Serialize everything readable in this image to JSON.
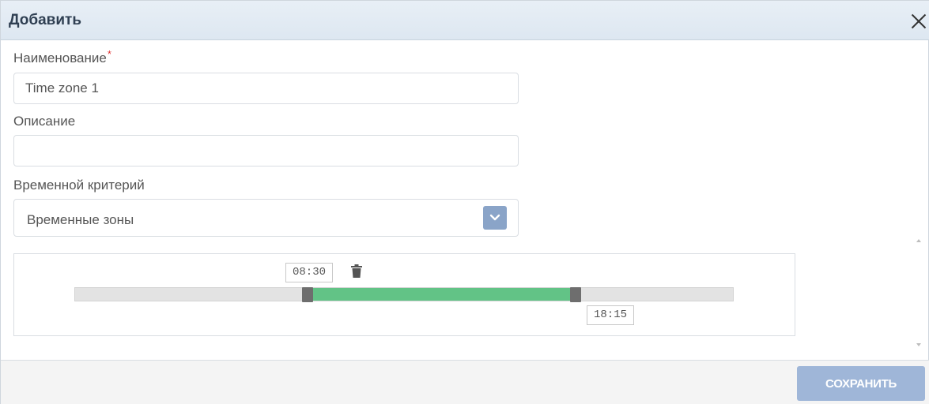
{
  "dialog": {
    "title": "Добавить"
  },
  "form": {
    "name_label": "Наименование",
    "required_mark": "*",
    "name_value": "Time zone 1",
    "description_label": "Описание",
    "description_value": "",
    "criterion_label": "Временной критерий",
    "criterion_selected": "Временные зоны"
  },
  "timeline": {
    "start_time": "08:30",
    "end_time": "18:15",
    "day_start": "00:00",
    "day_end": "24:00",
    "range_color": "#62c386"
  },
  "footer": {
    "save_label": "СОХРАНИТЬ"
  },
  "colors": {
    "title_bar": "#dde7f1",
    "accent_button": "#9fb6d8",
    "dropdown_button": "#8aa4c8",
    "required": "#e03333"
  }
}
